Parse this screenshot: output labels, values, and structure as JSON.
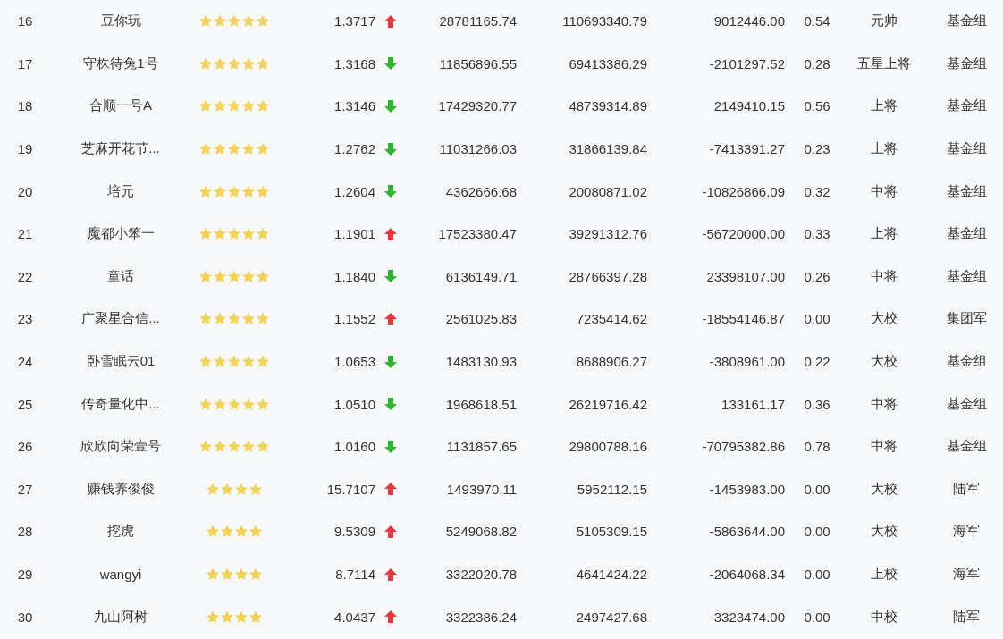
{
  "rows": [
    {
      "rank": "16",
      "name": "豆你玩",
      "stars": 5,
      "value": "1.3717",
      "rising": true,
      "column_5": "28781165.74",
      "column_6": "110693340.79",
      "column_7": "9012446.00",
      "column_8": "0.54",
      "column_9": "元帅",
      "column_10": "基金组"
    },
    {
      "rank": "17",
      "name": "守株待兔1号",
      "stars": 5,
      "value": "1.3168",
      "rising": false,
      "column_5": "11856896.55",
      "column_6": "69413386.29",
      "column_7": "-2101297.52",
      "column_8": "0.28",
      "column_9": "五星上将",
      "column_10": "基金组"
    },
    {
      "rank": "18",
      "name": "合顺一号A",
      "stars": 5,
      "value": "1.3146",
      "rising": false,
      "column_5": "17429320.77",
      "column_6": "48739314.89",
      "column_7": "2149410.15",
      "column_8": "0.56",
      "column_9": "上将",
      "column_10": "基金组"
    },
    {
      "rank": "19",
      "name": "芝麻开花节...",
      "stars": 5,
      "value": "1.2762",
      "rising": false,
      "column_5": "11031266.03",
      "column_6": "31866139.84",
      "column_7": "-7413391.27",
      "column_8": "0.23",
      "column_9": "上将",
      "column_10": "基金组"
    },
    {
      "rank": "20",
      "name": "培元",
      "stars": 5,
      "value": "1.2604",
      "rising": false,
      "column_5": "4362666.68",
      "column_6": "20080871.02",
      "column_7": "-10826866.09",
      "column_8": "0.32",
      "column_9": "中将",
      "column_10": "基金组"
    },
    {
      "rank": "21",
      "name": "魔都小笨一",
      "stars": 5,
      "value": "1.1901",
      "rising": true,
      "column_5": "17523380.47",
      "column_6": "39291312.76",
      "column_7": "-56720000.00",
      "column_8": "0.33",
      "column_9": "上将",
      "column_10": "基金组"
    },
    {
      "rank": "22",
      "name": "童话",
      "stars": 5,
      "value": "1.1840",
      "rising": false,
      "column_5": "6136149.71",
      "column_6": "28766397.28",
      "column_7": "23398107.00",
      "column_8": "0.26",
      "column_9": "中将",
      "column_10": "基金组"
    },
    {
      "rank": "23",
      "name": "广聚星合信...",
      "stars": 5,
      "value": "1.1552",
      "rising": true,
      "column_5": "2561025.83",
      "column_6": "7235414.62",
      "column_7": "-18554146.87",
      "column_8": "0.00",
      "column_9": "大校",
      "column_10": "集团军"
    },
    {
      "rank": "24",
      "name": "卧雪眠云01",
      "stars": 5,
      "value": "1.0653",
      "rising": false,
      "column_5": "1483130.93",
      "column_6": "8688906.27",
      "column_7": "-3808961.00",
      "column_8": "0.22",
      "column_9": "大校",
      "column_10": "基金组"
    },
    {
      "rank": "25",
      "name": "传奇量化中...",
      "stars": 5,
      "value": "1.0510",
      "rising": false,
      "column_5": "1968618.51",
      "column_6": "26219716.42",
      "column_7": "133161.17",
      "column_8": "0.36",
      "column_9": "中将",
      "column_10": "基金组"
    },
    {
      "rank": "26",
      "name": "欣欣向荣壹号",
      "stars": 5,
      "value": "1.0160",
      "rising": false,
      "column_5": "1131857.65",
      "column_6": "29800788.16",
      "column_7": "-70795382.86",
      "column_8": "0.78",
      "column_9": "中将",
      "column_10": "基金组"
    },
    {
      "rank": "27",
      "name": "赚钱养俊俊",
      "stars": 4,
      "value": "15.7107",
      "rising": true,
      "column_5": "1493970.11",
      "column_6": "5952112.15",
      "column_7": "-1453983.00",
      "column_8": "0.00",
      "column_9": "大校",
      "column_10": "陆军"
    },
    {
      "rank": "28",
      "name": "挖虎",
      "stars": 4,
      "value": "9.5309",
      "rising": true,
      "column_5": "5249068.82",
      "column_6": "5105309.15",
      "column_7": "-5863644.00",
      "column_8": "0.00",
      "column_9": "大校",
      "column_10": "海军"
    },
    {
      "rank": "29",
      "name": "wangyi",
      "stars": 4,
      "value": "8.7114",
      "rising": true,
      "column_5": "3322020.78",
      "column_6": "4641424.22",
      "column_7": "-2064068.34",
      "column_8": "0.00",
      "column_9": "上校",
      "column_10": "海军"
    },
    {
      "rank": "30",
      "name": "九山阿树",
      "stars": 4,
      "value": "4.0437",
      "rising": true,
      "column_5": "3322386.24",
      "column_6": "2497427.68",
      "column_7": "-3323474.00",
      "column_8": "0.00",
      "column_9": "中校",
      "column_10": "陆军"
    }
  ]
}
